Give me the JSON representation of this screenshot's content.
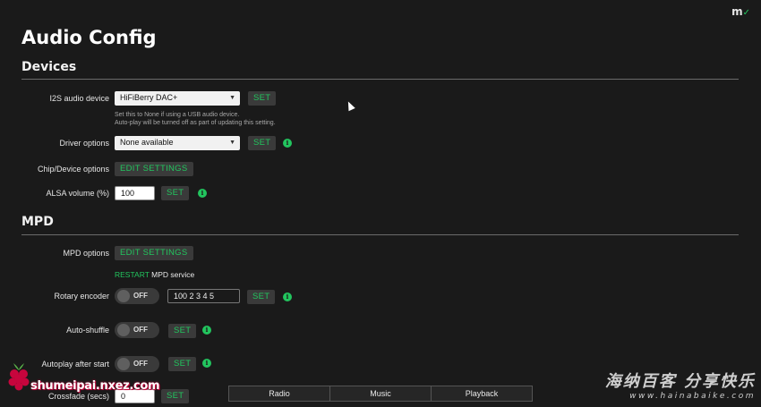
{
  "app": {
    "logo_text": "m",
    "logo_check": "✓"
  },
  "page_title": "Audio Config",
  "devices": {
    "title": "Devices",
    "i2s": {
      "label": "I2S audio device",
      "value": "HiFiBerry DAC+",
      "set_label": "SET",
      "hint_line1": "Set this to None if using a USB audio device.",
      "hint_line2": "Auto-play will be turned off as part of updating this setting."
    },
    "driver": {
      "label": "Driver options",
      "value": "None available",
      "set_label": "SET"
    },
    "chip": {
      "label": "Chip/Device options",
      "button_label": "EDIT SETTINGS"
    },
    "alsa": {
      "label": "ALSA volume (%)",
      "value": "100",
      "set_label": "SET"
    }
  },
  "mpd": {
    "title": "MPD",
    "options": {
      "label": "MPD options",
      "button_label": "EDIT SETTINGS"
    },
    "restart": {
      "link_label": "RESTART",
      "suffix": "MPD service"
    },
    "rotary": {
      "label": "Rotary encoder",
      "toggle_label": "OFF",
      "value": "100 2 3 4 5",
      "set_label": "SET"
    },
    "shuffle": {
      "label": "Auto-shuffle",
      "toggle_label": "OFF",
      "set_label": "SET"
    },
    "autoplay": {
      "label": "Autoplay after start",
      "toggle_label": "OFF",
      "set_label": "SET"
    },
    "crossfade": {
      "label": "Crossfade (secs)",
      "value": "0",
      "set_label": "SET"
    }
  },
  "footer_tabs": [
    "Radio",
    "Music",
    "Playback"
  ],
  "watermarks": {
    "left": "shumeipai.nxez.com",
    "right_cn": "海纳百客 分享快乐",
    "right_url": "www.hainabaike.com"
  },
  "colors": {
    "accent": "#22c55e",
    "background": "#1a1a1a",
    "button_bg": "#3a3a3a"
  }
}
